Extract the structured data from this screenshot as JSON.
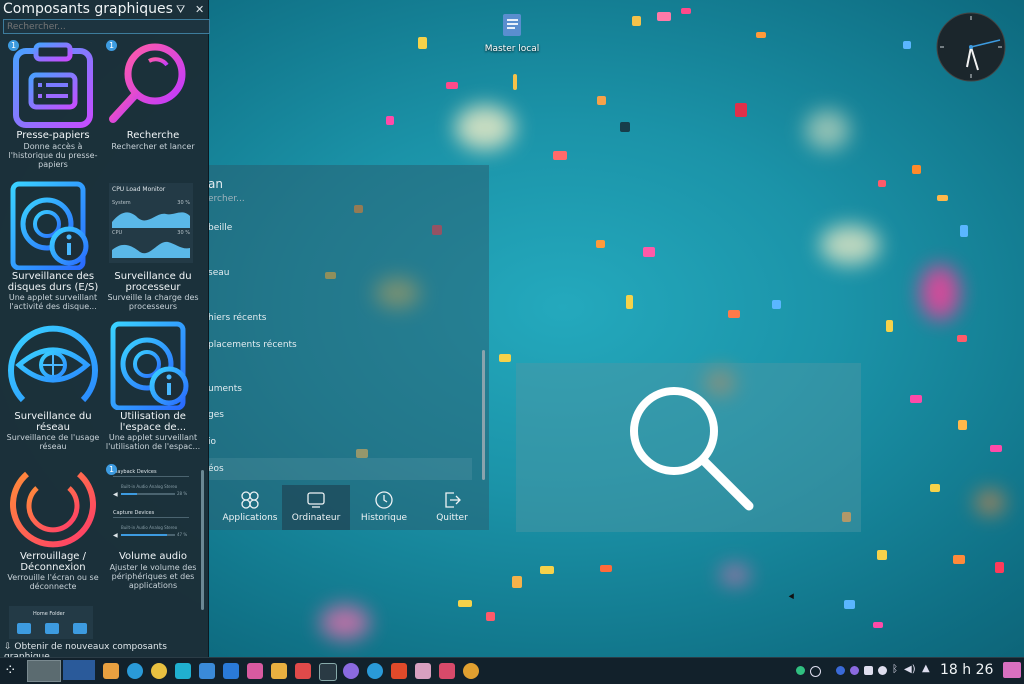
{
  "widgets_panel": {
    "title": "Composants graphiques",
    "search_placeholder": "Rechercher...",
    "get_new_label": "Obtenir de nouveaux composants graphique...",
    "widgets": [
      {
        "name": "Presse-papiers",
        "desc": "Donne accès à l'historique du presse-papiers",
        "badge": "1",
        "icon": "clipboard-icon"
      },
      {
        "name": "Recherche",
        "desc": "Rechercher et lancer",
        "badge": "1",
        "icon": "search-icon"
      },
      {
        "name": "Surveillance des disques durs (E/S)",
        "desc": "Une applet surveillant l'activité des disque...",
        "icon": "disk-info-icon"
      },
      {
        "name": "Surveillance du processeur",
        "desc": "Surveille la charge des processeurs",
        "icon": "cpu-monitor-preview"
      },
      {
        "name": "Surveillance du réseau",
        "desc": "Surveillance de l'usage réseau",
        "icon": "network-eye-icon"
      },
      {
        "name": "Utilisation de l'espace de...",
        "desc": "Une applet surveillant l'utilisation de l'espac...",
        "icon": "disk-usage-icon"
      },
      {
        "name": "Verrouillage / Déconnexion",
        "desc": "Verrouille l'écran ou se déconnecte",
        "icon": "power-icon"
      },
      {
        "name": "Volume audio",
        "desc": "Ajuster le volume des périphériques et des applications",
        "badge": "1",
        "icon": "volume-preview"
      }
    ],
    "cpu_preview": {
      "title": "CPU Load Monitor",
      "system_label": "System",
      "system_value": "30 %",
      "cpu_label": "CPU",
      "cpu_value": "30 %"
    },
    "volume_preview": {
      "playback": "Playback Devices",
      "playback_dev": "Built-in Audio Analog Stereo",
      "playback_pct": "28 %",
      "capture": "Capture Devices",
      "capture_dev": "Built-in Audio Analog Stereo",
      "capture_pct": "47 %"
    },
    "home_folder": "Home Folder"
  },
  "launcher": {
    "header_partial": "an",
    "search_partial": "ercher...",
    "rows": [
      "beille",
      "seau",
      "hiers récents",
      "placements récents",
      "uments",
      "ges",
      "io",
      "éos"
    ],
    "tabs": [
      "Applications",
      "Ordinateur",
      "Historique",
      "Quitter"
    ]
  },
  "desktop": {
    "icon_label": "Master local"
  },
  "taskbar": {
    "time": "18 h 26"
  },
  "colors": {
    "accent": "#3d9be0",
    "panel_bg": "#1c2e38"
  }
}
